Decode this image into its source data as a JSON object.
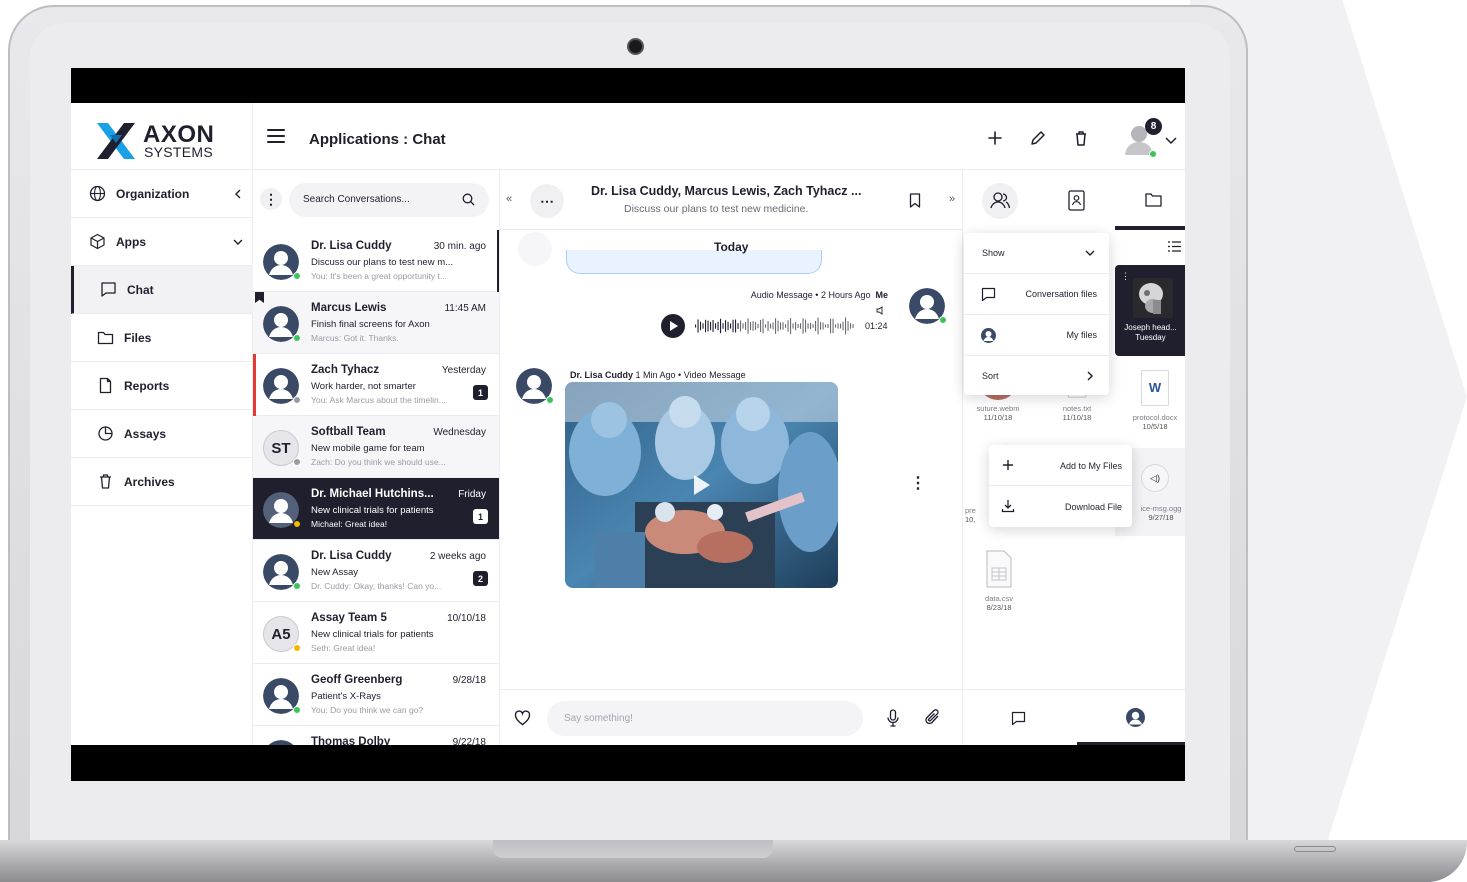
{
  "brand": {
    "name": "AXON",
    "sub": "SYSTEMS"
  },
  "header": {
    "page_title": "Applications : Chat",
    "notification_count": "8"
  },
  "sidebar": {
    "items": [
      {
        "label": "Organization",
        "icon": "globe-icon"
      },
      {
        "label": "Apps",
        "icon": "cube-icon"
      },
      {
        "label": "Chat",
        "icon": "chat-icon",
        "active": true
      },
      {
        "label": "Files",
        "icon": "folder-icon"
      },
      {
        "label": "Reports",
        "icon": "document-icon"
      },
      {
        "label": "Assays",
        "icon": "pie-chart-icon"
      },
      {
        "label": "Archives",
        "icon": "trash-icon"
      }
    ]
  },
  "search": {
    "placeholder": "Search Conversations..."
  },
  "conversations": [
    {
      "name": "Dr. Lisa Cuddy",
      "time": "30 min. ago",
      "subject": "Discuss our plans to test new m...",
      "preview": "You: It's been a great opportunity t...",
      "status": "online"
    },
    {
      "name": "Marcus Lewis",
      "time": "11:45 AM",
      "subject": "Finish final screens for Axon",
      "preview": "Marcus: Got it. Thanks.",
      "status": "online"
    },
    {
      "name": "Zach Tyhacz",
      "time": "Yesterday",
      "subject": "Work harder, not smarter",
      "preview": "You: Ask Marcus about the timelin...",
      "status": "offline",
      "count": "1"
    },
    {
      "name": "Softball Team",
      "initials": "ST",
      "time": "Wednesday",
      "subject": "New mobile game for team",
      "preview": "Zach: Do you think we should use...",
      "status": "offline"
    },
    {
      "name": "Dr. Michael Hutchins...",
      "time": "Friday",
      "subject": "New clinical trials for patients",
      "preview": "Michael: Great idea!",
      "status": "away",
      "count": "1"
    },
    {
      "name": "Dr. Lisa Cuddy",
      "time": "2 weeks ago",
      "subject": "New Assay",
      "preview": "Dr. Cuddy: Okay, thanks! Can yo...",
      "status": "online",
      "count": "2"
    },
    {
      "name": "Assay Team 5",
      "initials": "A5",
      "time": "10/10/18",
      "subject": "New clinical trials for patients",
      "preview": "Seth: Great idea!",
      "status": "away"
    },
    {
      "name": "Geoff Greenberg",
      "time": "9/28/18",
      "subject": "Patient's X-Rays",
      "preview": "You: Do you think we can go?",
      "status": "online"
    },
    {
      "name": "Thomas Dolby",
      "time": "9/22/18",
      "subject": "",
      "preview": "",
      "status": "online"
    }
  ],
  "chat": {
    "title": "Dr. Lisa Cuddy, Marcus Lewis, Zach Tyhacz ...",
    "subtitle": "Discuss our plans to test new medicine.",
    "day_label": "Today",
    "audio": {
      "meta": "Audio Message • 2 Hours Ago",
      "author": "Me",
      "duration": "01:24"
    },
    "video": {
      "author": "Dr. Lisa Cuddy",
      "meta": "1 Min Ago • Video Message"
    },
    "composer_placeholder": "Say something!"
  },
  "files_panel": {
    "show_menu": {
      "header": "Show",
      "items": [
        "Conversation files",
        "My files"
      ],
      "sort": "Sort"
    },
    "files": [
      {
        "name": "Joseph head...",
        "date": "Tuesday"
      },
      {
        "name": "suture.webm",
        "date": "11/10/18"
      },
      {
        "name": "notes.txt",
        "date": "11/10/18"
      },
      {
        "name": "protocol.docx",
        "date": "10/5/18"
      },
      {
        "name": "pre",
        "date": "10,"
      },
      {
        "name": "ice-msg.ogg",
        "date": "9/27/18"
      },
      {
        "name": "data.csv",
        "date": "8/23/18"
      }
    ],
    "file_menu": [
      "Add to My Files",
      "Download File"
    ]
  },
  "colors": {
    "brand_dark": "#1f1f2e",
    "online": "#3bc45b",
    "away": "#f5b700",
    "offline": "#9a9aa4",
    "alert": "#e53935",
    "logo_blue": "#1aa0e6"
  }
}
